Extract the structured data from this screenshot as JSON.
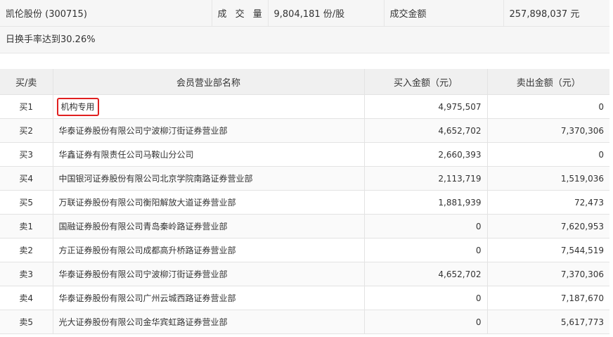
{
  "summary": {
    "stock": "凯伦股份 (300715)",
    "volume_label": "成 交 量",
    "volume_value": "9,804,181 份/股",
    "amount_label": "成交金额",
    "amount_value": "257,898,037 元",
    "turnover_text": "日换手率达到30.26%"
  },
  "table": {
    "headers": [
      "买/卖",
      "会员营业部名称",
      "买入金额（元）",
      "卖出金额（元）"
    ],
    "rows": [
      {
        "side": "买1",
        "name": "机构专用",
        "buy": "4,975,507",
        "sell": "0"
      },
      {
        "side": "买2",
        "name": "华泰证券股份有限公司宁波柳汀街证券营业部",
        "buy": "4,652,702",
        "sell": "7,370,306"
      },
      {
        "side": "买3",
        "name": "华鑫证券有限责任公司马鞍山分公司",
        "buy": "2,660,393",
        "sell": "0"
      },
      {
        "side": "买4",
        "name": "中国银河证券股份有限公司北京学院南路证券营业部",
        "buy": "2,113,719",
        "sell": "1,519,036"
      },
      {
        "side": "买5",
        "name": "万联证券股份有限公司衡阳解放大道证券营业部",
        "buy": "1,881,939",
        "sell": "72,473"
      },
      {
        "side": "卖1",
        "name": "国融证券股份有限公司青岛秦岭路证券营业部",
        "buy": "0",
        "sell": "7,620,953"
      },
      {
        "side": "卖2",
        "name": "方正证券股份有限公司成都高升桥路证券营业部",
        "buy": "0",
        "sell": "7,544,519"
      },
      {
        "side": "卖3",
        "name": "华泰证券股份有限公司宁波柳汀街证券营业部",
        "buy": "4,652,702",
        "sell": "7,370,306"
      },
      {
        "side": "卖4",
        "name": "华泰证券股份有限公司广州云城西路证券营业部",
        "buy": "0",
        "sell": "7,187,670"
      },
      {
        "side": "卖5",
        "name": "光大证券股份有限公司金华宾虹路证券营业部",
        "buy": "0",
        "sell": "5,617,773"
      }
    ]
  },
  "colors": {
    "highlight_border": "#e02020"
  }
}
